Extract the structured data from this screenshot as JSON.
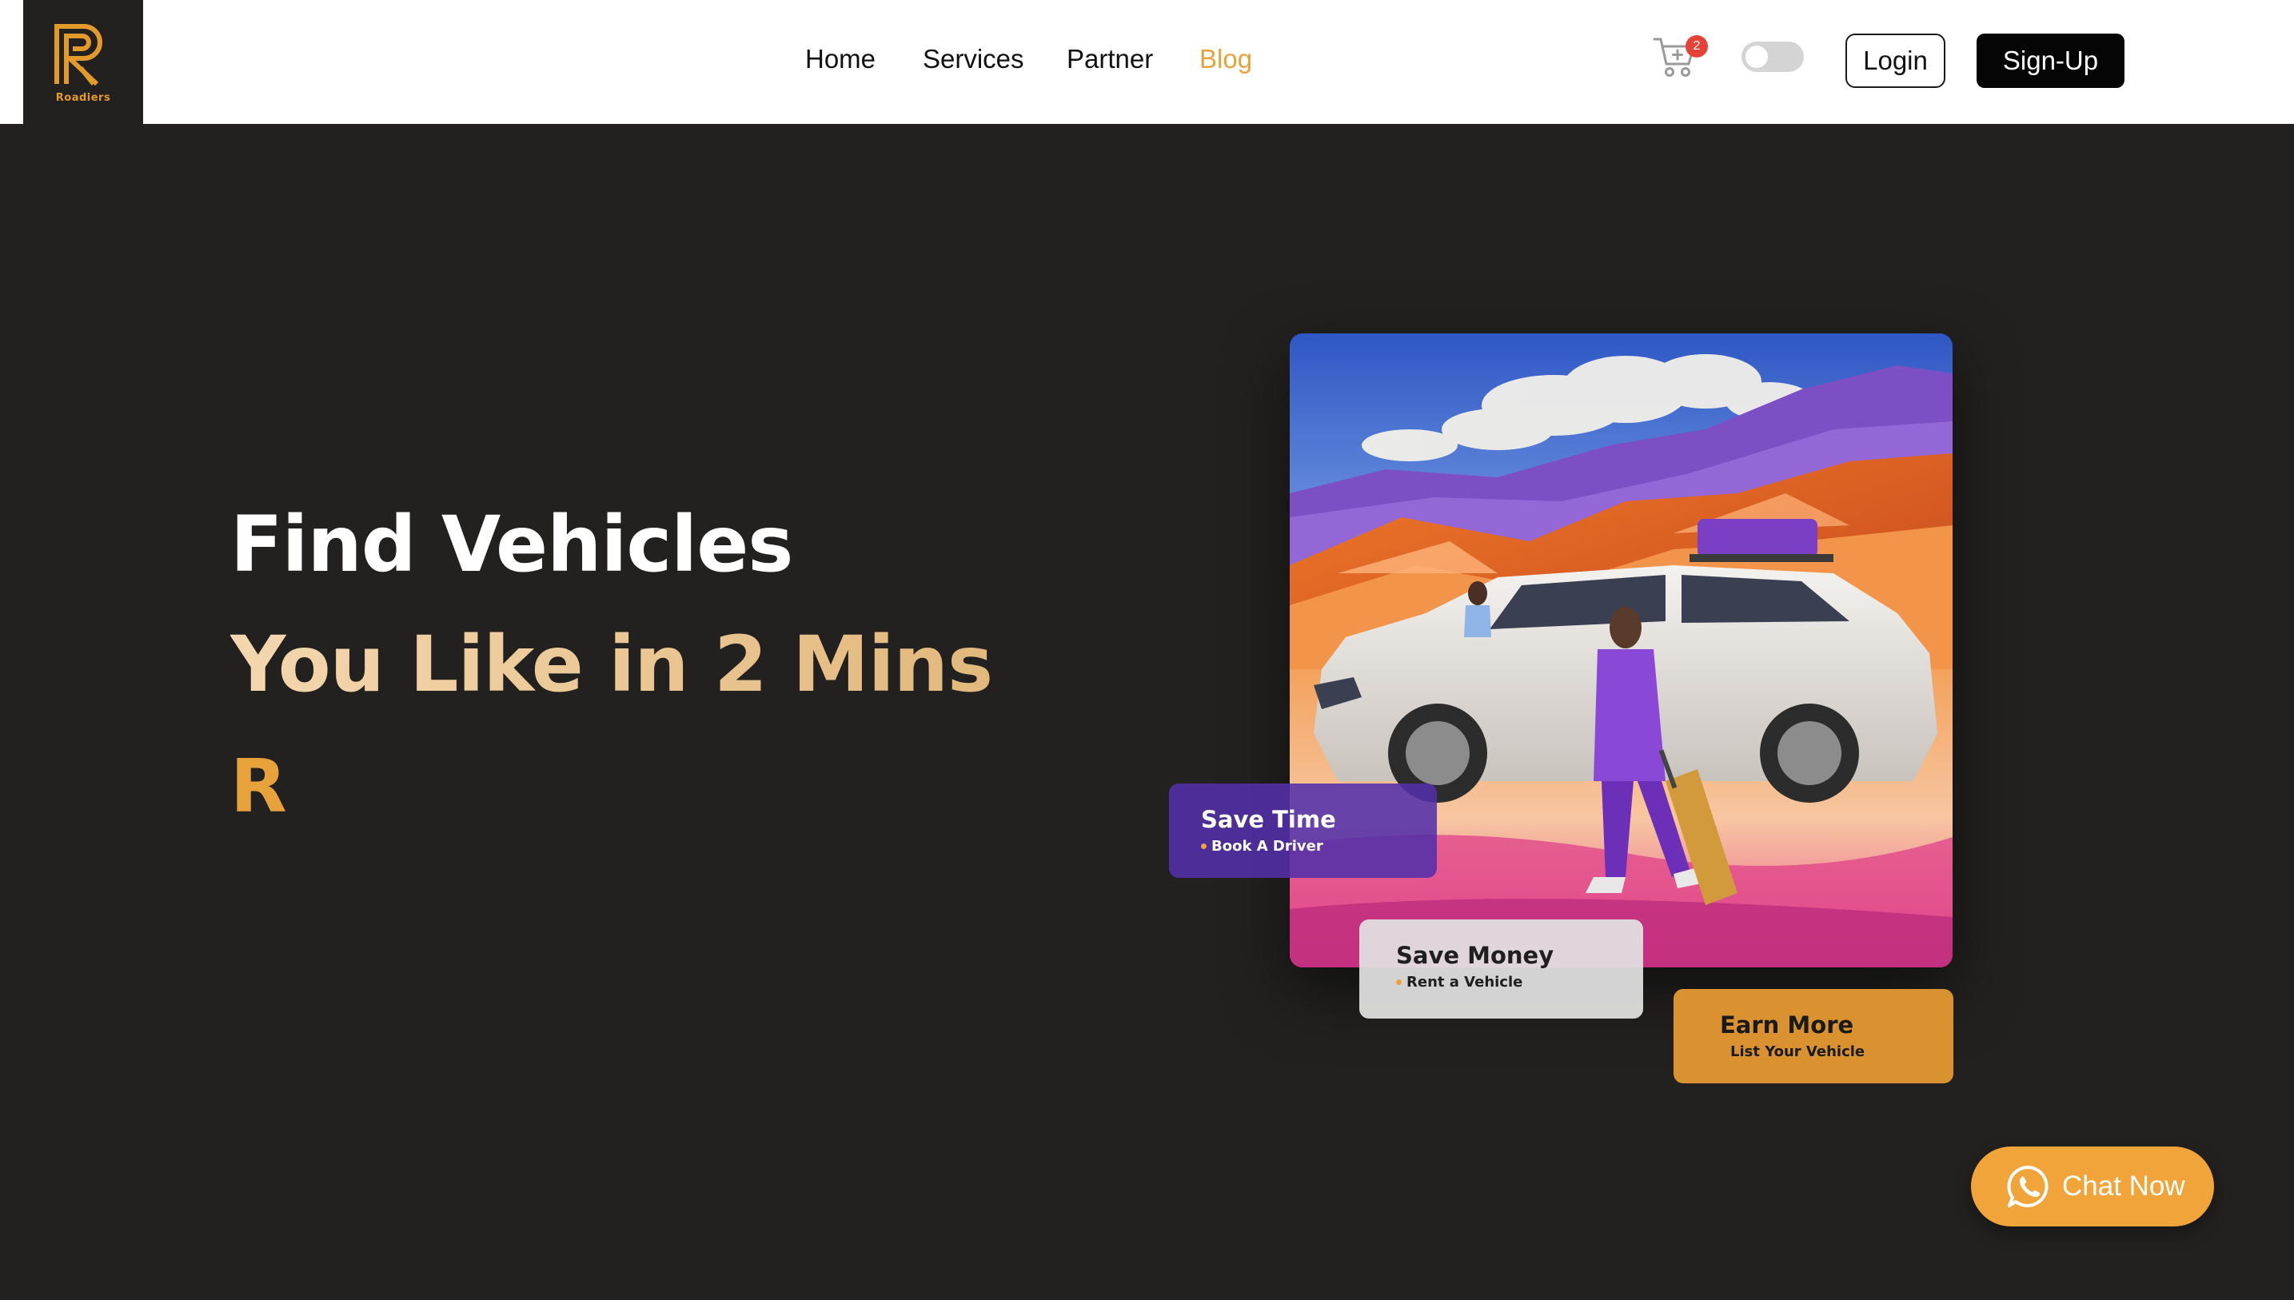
{
  "brand": {
    "name": "Roadiers",
    "colors": {
      "accent": "#e8a23c",
      "dark": "#222120",
      "purple": "#5330aa"
    }
  },
  "nav": {
    "items": [
      {
        "label": "Home",
        "active": false
      },
      {
        "label": "Services",
        "active": false
      },
      {
        "label": "Partner",
        "active": false
      },
      {
        "label": "Blog",
        "active": true
      }
    ]
  },
  "header_actions": {
    "cart_icon": "cart-icon",
    "cart_count": "2",
    "theme_toggle": "off",
    "login_label": "Login",
    "signup_label": "Sign-Up"
  },
  "hero": {
    "line1": "Find Vehicles",
    "line2": "You Like in 2 Mins",
    "line3": "R"
  },
  "cards": [
    {
      "title": "Save Time",
      "subtitle": "Book A Driver"
    },
    {
      "title": "Save Money",
      "subtitle": "Rent a Vehicle"
    },
    {
      "title": "Earn More",
      "subtitle": "List Your Vehicle"
    }
  ],
  "chat": {
    "label": "Chat Now",
    "icon": "whatsapp-icon"
  }
}
